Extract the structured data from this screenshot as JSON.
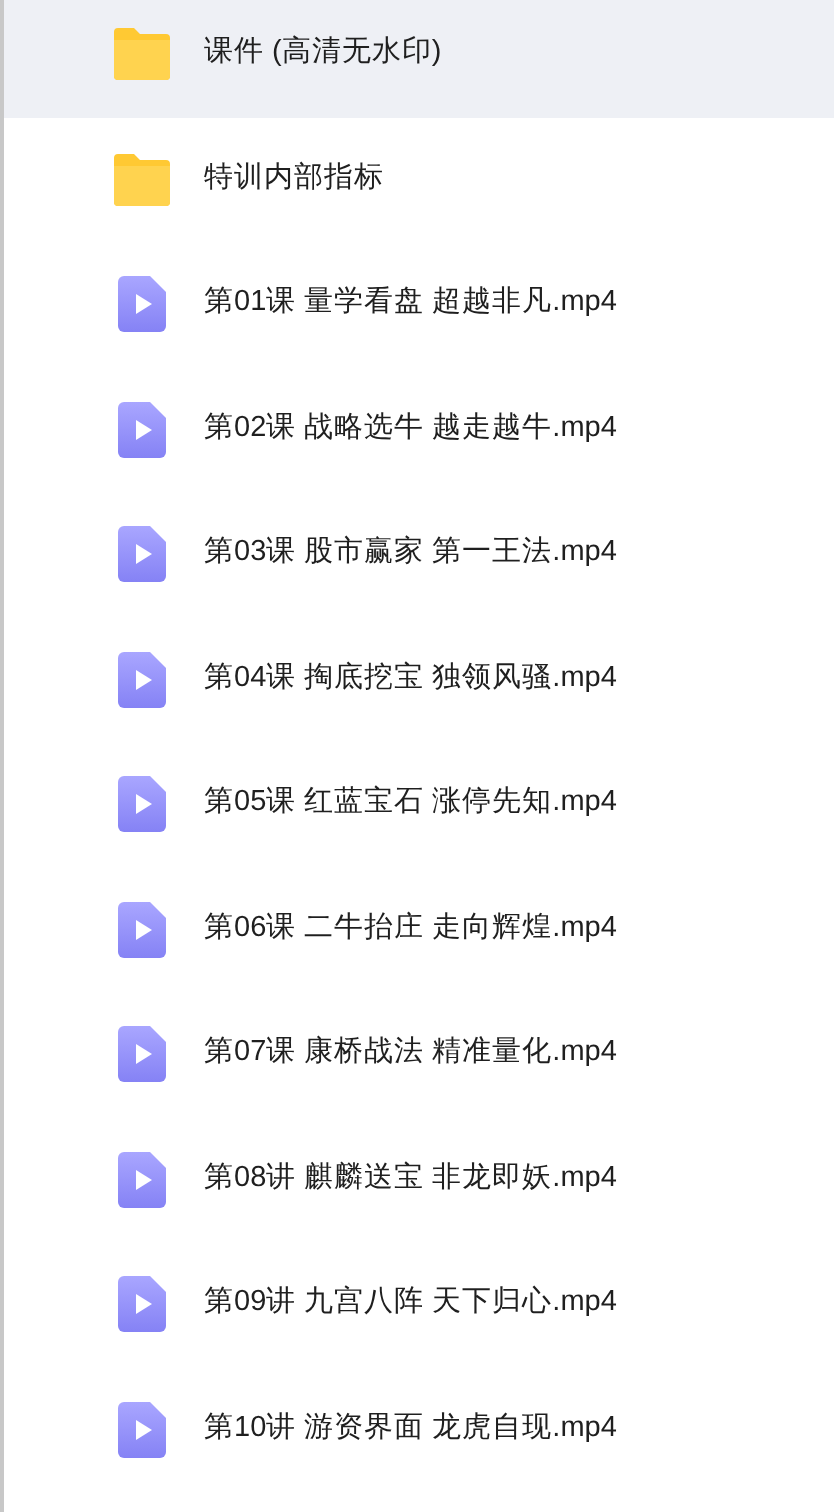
{
  "files": [
    {
      "kind": "folder",
      "name": "课件 (高清无水印)",
      "selected": true
    },
    {
      "kind": "folder",
      "name": "特训内部指标",
      "selected": false
    },
    {
      "kind": "video",
      "name": "第01课 量学看盘 超越非凡.mp4",
      "selected": false
    },
    {
      "kind": "video",
      "name": "第02课 战略选牛 越走越牛.mp4",
      "selected": false
    },
    {
      "kind": "video",
      "name": "第03课 股市赢家 第一王法.mp4",
      "selected": false
    },
    {
      "kind": "video",
      "name": "第04课 掏底挖宝 独领风骚.mp4",
      "selected": false
    },
    {
      "kind": "video",
      "name": "第05课 红蓝宝石 涨停先知.mp4",
      "selected": false
    },
    {
      "kind": "video",
      "name": "第06课 二牛抬庄 走向辉煌.mp4",
      "selected": false
    },
    {
      "kind": "video",
      "name": "第07课 康桥战法 精准量化.mp4",
      "selected": false
    },
    {
      "kind": "video",
      "name": "第08讲 麒麟送宝 非龙即妖.mp4",
      "selected": false
    },
    {
      "kind": "video",
      "name": "第09讲 九宫八阵 天下归心.mp4",
      "selected": false
    },
    {
      "kind": "video",
      "name": "第10讲 游资界面 龙虎自现.mp4",
      "selected": false
    }
  ]
}
